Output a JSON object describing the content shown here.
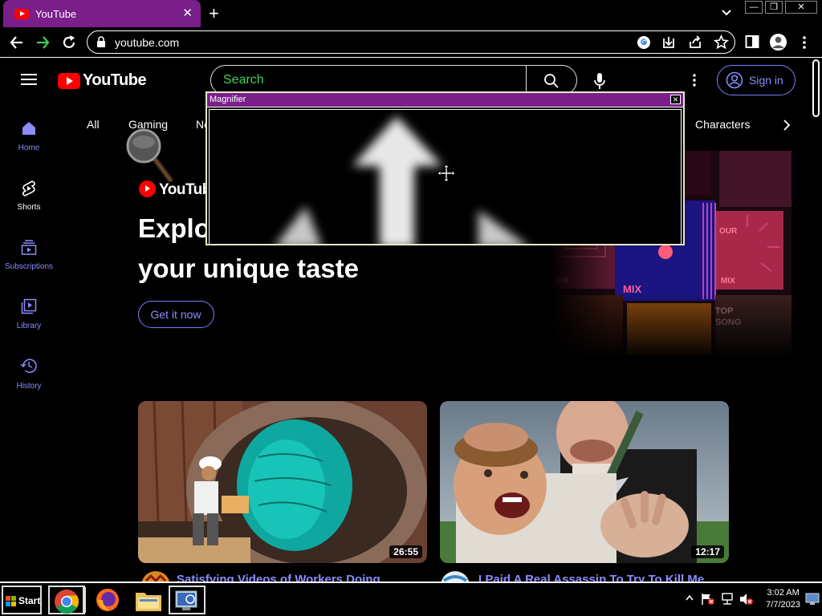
{
  "browser": {
    "tab_title": "YouTube",
    "url": "youtube.com"
  },
  "youtube": {
    "logo_text": "YouTube",
    "search_placeholder": "Search",
    "signin_label": "Sign in",
    "sidebar": [
      {
        "label": "Home"
      },
      {
        "label": "Shorts"
      },
      {
        "label": "Subscriptions"
      },
      {
        "label": "Library"
      },
      {
        "label": "History"
      }
    ],
    "chips": [
      "All",
      "Gaming",
      "Ne",
      "Characters"
    ],
    "promo": {
      "logo_text": "YouTube",
      "headline_1": "Explo",
      "headline_2": "your unique taste",
      "cta": "Get it now",
      "tiles": [
        "MIX",
        "OUR",
        "MIX",
        "MIX",
        "TOP",
        "SONG"
      ]
    },
    "videos": [
      {
        "title": "Satisfying Videos of Workers Doing",
        "duration": "26:55"
      },
      {
        "title": "I Paid A Real Assassin To Try To Kill Me",
        "duration": "12:17"
      }
    ]
  },
  "magnifier": {
    "title": "Magnifier"
  },
  "taskbar": {
    "start_label": "Start",
    "time": "3:02 AM",
    "date": "7/7/2023"
  },
  "colors": {
    "accent": "#8c8cff",
    "tab_purple": "#7a1f8a",
    "search_placeholder": "#3fd05a",
    "youtube_red": "#ff0000"
  }
}
